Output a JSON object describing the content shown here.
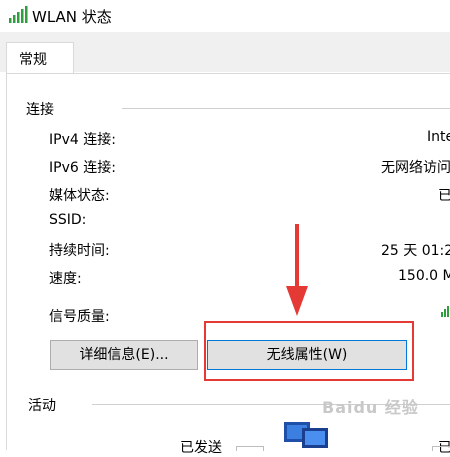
{
  "window": {
    "title": "WLAN 状态"
  },
  "tabs": [
    {
      "label": "常规"
    }
  ],
  "connection": {
    "group_label": "连接",
    "rows": [
      {
        "label": "IPv4 连接:",
        "value": "Inte"
      },
      {
        "label": "IPv6 连接:",
        "value": "无网络访问"
      },
      {
        "label": "媒体状态:",
        "value": "已"
      },
      {
        "label": "SSID:",
        "value": ""
      },
      {
        "label": "持续时间:",
        "value": "25 天 01:2"
      },
      {
        "label": "速度:",
        "value": "150.0 M"
      }
    ],
    "signal_label": "信号质量:"
  },
  "buttons": {
    "details": "详细信息(E)...",
    "wireless_properties": "无线属性(W)"
  },
  "activity": {
    "group_label": "活动",
    "sent_label": "已发送",
    "received_label": "已"
  },
  "watermark_text": "Baidu 经验",
  "colors": {
    "highlight_border": "#e53935",
    "arrow": "#e53935",
    "focus_border": "#0078d7",
    "signal_green": "#2e9e3f"
  }
}
